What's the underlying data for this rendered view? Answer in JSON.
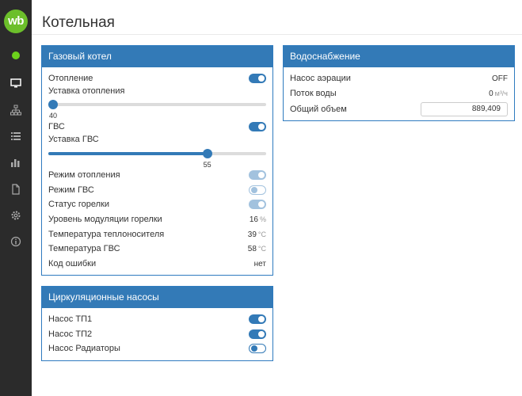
{
  "sidebar": {
    "logo_text": "wb",
    "status_color": "#6cd11c",
    "items": [
      {
        "icon": "monitor-icon"
      },
      {
        "icon": "network-icon"
      },
      {
        "icon": "list-icon"
      },
      {
        "icon": "bar-chart-icon"
      },
      {
        "icon": "file-icon"
      },
      {
        "icon": "gear-icon"
      },
      {
        "icon": "info-icon"
      }
    ]
  },
  "header": {
    "title": "Котельная"
  },
  "boiler": {
    "title": "Газовый котел",
    "heating": {
      "label": "Отопление",
      "state": "on"
    },
    "heating_setpoint": {
      "label": "Уставка отопления",
      "value": "40",
      "fraction": 0.0
    },
    "dhw": {
      "label": "ГВС",
      "state": "on"
    },
    "dhw_setpoint": {
      "label": "Уставка ГВС",
      "value": "55",
      "fraction": 0.74
    },
    "heating_mode": {
      "label": "Режим отопления",
      "state": "on-disabled"
    },
    "dhw_mode": {
      "label": "Режим ГВС",
      "state": "off-disabled"
    },
    "burner_status": {
      "label": "Статус горелки",
      "state": "on-disabled"
    },
    "modulation": {
      "label": "Уровень модуляции горелки",
      "value": "16",
      "unit": "%"
    },
    "coolant_temp": {
      "label": "Температура теплоносителя",
      "value": "39",
      "unit": "°C"
    },
    "dhw_temp": {
      "label": "Температура ГВС",
      "value": "58",
      "unit": "°C"
    },
    "error_code": {
      "label": "Код ошибки",
      "value": "нет"
    }
  },
  "pumps": {
    "title": "Циркуляционные насосы",
    "tp1": {
      "label": "Насос ТП1",
      "state": "on"
    },
    "tp2": {
      "label": "Насос ТП2",
      "state": "on"
    },
    "radiators": {
      "label": "Насос Радиаторы",
      "state": "off"
    }
  },
  "water": {
    "title": "Водоснабжение",
    "aeration_pump": {
      "label": "Насос аэрации",
      "value": "OFF"
    },
    "water_flow": {
      "label": "Поток воды",
      "value": "0",
      "unit": "м³/ч"
    },
    "total_volume": {
      "label": "Общий объем",
      "value": "889,409"
    }
  },
  "colors": {
    "accent": "#337ab7",
    "sidebar": "#2b2b2b",
    "logo": "#6cbf2b"
  }
}
